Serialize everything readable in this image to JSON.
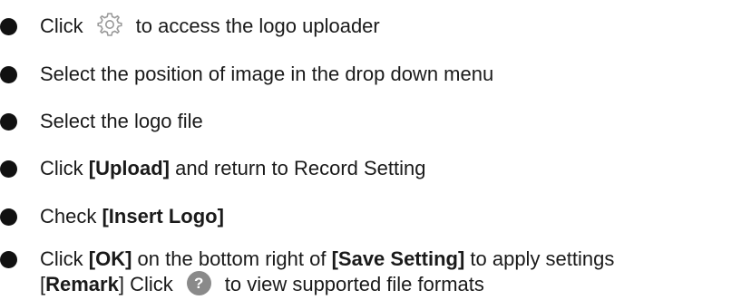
{
  "steps": [
    {
      "pre": "Click",
      "icon": "gear-icon",
      "post": "to access the logo uploader"
    },
    {
      "text": "Select the position of image in the drop down menu"
    },
    {
      "text": "Select the logo file"
    },
    {
      "pre": "Click ",
      "bold": "[Upload]",
      "post": " and return to Record Setting"
    },
    {
      "pre": "Check ",
      "bold": "[Insert Logo]"
    },
    {
      "pre": "Click ",
      "bold": "[OK]",
      "mid": " on the bottom right of ",
      "bold2": "[Save Setting]",
      "post": " to apply settings"
    }
  ],
  "remark": {
    "open": "[",
    "label": "Remark",
    "close": "]",
    "pre": " Click",
    "icon": "help-icon",
    "icon_glyph": "?",
    "post": "to view supported file formats"
  },
  "colors": {
    "text": "#1a1a1a",
    "bullet": "#111111",
    "help_icon_bg": "#8a8a8a",
    "gear_icon": "#9a9a9a"
  }
}
